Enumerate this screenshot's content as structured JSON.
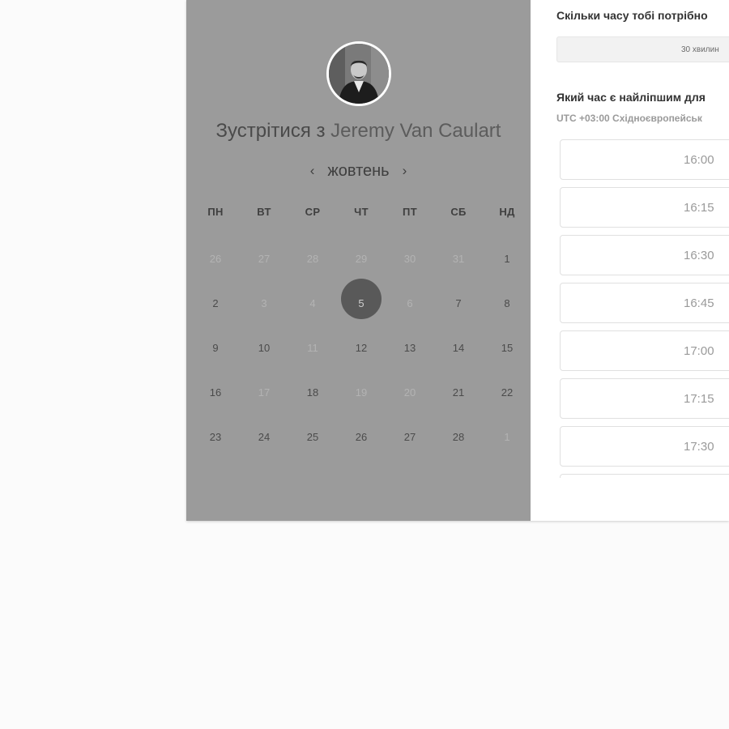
{
  "host": {
    "title_prefix": "Зустрітися з",
    "name": "Jeremy Van Caulart"
  },
  "calendar": {
    "month": "жовтень",
    "prev_icon": "chevron-left-icon",
    "next_icon": "chevron-right-icon",
    "weekdays": [
      "пн",
      "вт",
      "ср",
      "чт",
      "пт",
      "сб",
      "нд"
    ],
    "selected_day": "5",
    "days": [
      {
        "label": "26",
        "muted": true
      },
      {
        "label": "27",
        "muted": true
      },
      {
        "label": "28",
        "muted": true
      },
      {
        "label": "29",
        "muted": true
      },
      {
        "label": "30",
        "muted": true
      },
      {
        "label": "31",
        "muted": true
      },
      {
        "label": "1",
        "muted": false
      },
      {
        "label": "2",
        "muted": false
      },
      {
        "label": "3",
        "muted": true
      },
      {
        "label": "4",
        "muted": true
      },
      {
        "label": "5",
        "muted": false,
        "selected": true
      },
      {
        "label": "6",
        "muted": true
      },
      {
        "label": "7",
        "muted": false
      },
      {
        "label": "8",
        "muted": false
      },
      {
        "label": "9",
        "muted": false
      },
      {
        "label": "10",
        "muted": false
      },
      {
        "label": "11",
        "muted": true
      },
      {
        "label": "12",
        "muted": false
      },
      {
        "label": "13",
        "muted": false
      },
      {
        "label": "14",
        "muted": false
      },
      {
        "label": "15",
        "muted": false
      },
      {
        "label": "16",
        "muted": false
      },
      {
        "label": "17",
        "muted": true
      },
      {
        "label": "18",
        "muted": false
      },
      {
        "label": "19",
        "muted": true
      },
      {
        "label": "20",
        "muted": true
      },
      {
        "label": "21",
        "muted": false
      },
      {
        "label": "22",
        "muted": false
      },
      {
        "label": "23",
        "muted": false
      },
      {
        "label": "24",
        "muted": false
      },
      {
        "label": "25",
        "muted": false
      },
      {
        "label": "26",
        "muted": false
      },
      {
        "label": "27",
        "muted": false
      },
      {
        "label": "28",
        "muted": false
      },
      {
        "label": "1",
        "muted": true
      }
    ]
  },
  "booking": {
    "duration_question": "Скільки часу тобі потрібно",
    "duration_value": "30 хвилин",
    "time_question": "Який час є найліпшим для",
    "timezone": "UTC +03:00 Східноєвропейськ",
    "slots": [
      "16:00",
      "16:15",
      "16:30",
      "16:45",
      "17:00",
      "17:15",
      "17:30"
    ]
  },
  "colors": {
    "calendar_panel": "#9b9b9b",
    "selected_day": "#595959",
    "page_background": "#fbfbfb"
  }
}
